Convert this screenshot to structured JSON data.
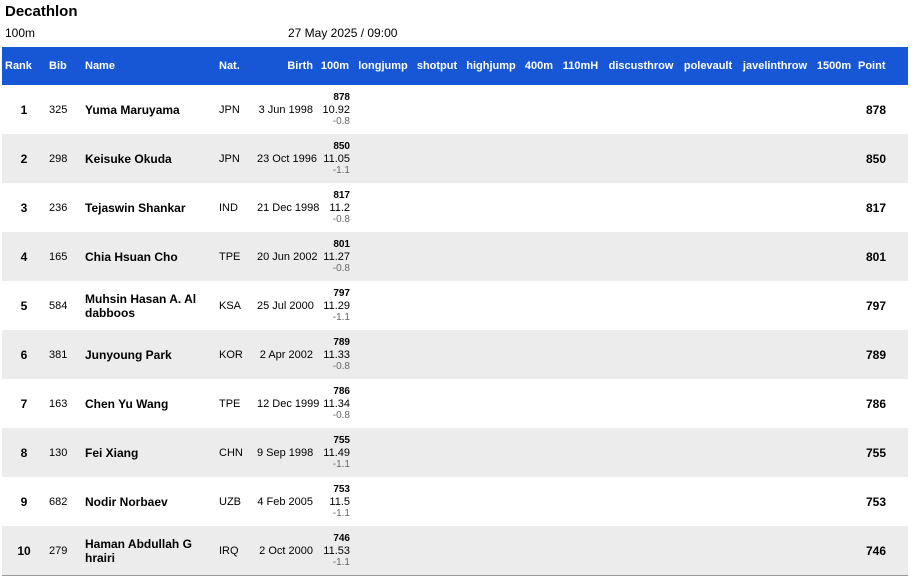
{
  "header": {
    "title": "Decathlon",
    "event": "100m",
    "datetime": "27 May 2025 / 09:00"
  },
  "columns": {
    "rank": "Rank",
    "bib": "Bib",
    "name": "Name",
    "nat": "Nat.",
    "birth": "Birth",
    "e100m": "100m",
    "longjump": "longjump",
    "shotput": "shotput",
    "highjump": "highjump",
    "e400m": "400m",
    "e110mh": "110mH",
    "discusthrow": "discusthrow",
    "polevault": "polevault",
    "javelinthrow": "javelinthrow",
    "e1500m": "1500m",
    "point": "Point"
  },
  "colors": {
    "header_bg": "#1757d6",
    "alt_row": "#ececec"
  },
  "rows": [
    {
      "rank": "1",
      "bib": "325",
      "name": "Yuma Maruyama",
      "nat": "JPN",
      "birth": "3 Jun 1998",
      "pts": "878",
      "time": "10.92",
      "wind": "-0.8",
      "point": "878"
    },
    {
      "rank": "2",
      "bib": "298",
      "name": "Keisuke Okuda",
      "nat": "JPN",
      "birth": "23 Oct 1996",
      "pts": "850",
      "time": "11.05",
      "wind": "-1.1",
      "point": "850"
    },
    {
      "rank": "3",
      "bib": "236",
      "name": "Tejaswin Shankar",
      "nat": "IND",
      "birth": "21 Dec 1998",
      "pts": "817",
      "time": "11.2",
      "wind": "-0.8",
      "point": "817"
    },
    {
      "rank": "4",
      "bib": "165",
      "name": "Chia Hsuan Cho",
      "nat": "TPE",
      "birth": "20 Jun 2002",
      "pts": "801",
      "time": "11.27",
      "wind": "-0.8",
      "point": "801"
    },
    {
      "rank": "5",
      "bib": "584",
      "name": "Muhsin Hasan A. Al dabboos",
      "nat": "KSA",
      "birth": "25 Jul 2000",
      "pts": "797",
      "time": "11.29",
      "wind": "-1.1",
      "point": "797"
    },
    {
      "rank": "6",
      "bib": "381",
      "name": "Junyoung Park",
      "nat": "KOR",
      "birth": "2 Apr 2002",
      "pts": "789",
      "time": "11.33",
      "wind": "-0.8",
      "point": "789"
    },
    {
      "rank": "7",
      "bib": "163",
      "name": "Chen Yu Wang",
      "nat": "TPE",
      "birth": "12 Dec 1999",
      "pts": "786",
      "time": "11.34",
      "wind": "-0.8",
      "point": "786"
    },
    {
      "rank": "8",
      "bib": "130",
      "name": "Fei Xiang",
      "nat": "CHN",
      "birth": "9 Sep 1998",
      "pts": "755",
      "time": "11.49",
      "wind": "-1.1",
      "point": "755"
    },
    {
      "rank": "9",
      "bib": "682",
      "name": "Nodir Norbaev",
      "nat": "UZB",
      "birth": "4 Feb 2005",
      "pts": "753",
      "time": "11.5",
      "wind": "-1.1",
      "point": "753"
    },
    {
      "rank": "10",
      "bib": "279",
      "name": "Haman Abdullah G hrairi",
      "nat": "IRQ",
      "birth": "2 Oct 2000",
      "pts": "746",
      "time": "11.53",
      "wind": "-1.1",
      "point": "746"
    }
  ]
}
